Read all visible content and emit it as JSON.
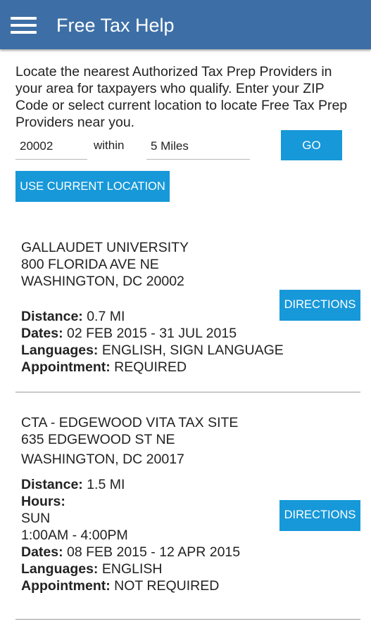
{
  "app": {
    "title": "Free Tax Help"
  },
  "intro": "Locate the nearest Authorized Tax Prep Providers in your area for taxpayers who qualify. Enter your ZIP Code or select current location to locate Free Tax Prep Providers near you.",
  "search": {
    "zip_value": "20002",
    "within_label": "within",
    "range_value": "5 Miles",
    "go_label": "GO",
    "use_location_label": "USE CURRENT LOCATION"
  },
  "labels": {
    "distance": "Distance:",
    "hours": "Hours:",
    "dates": "Dates:",
    "languages": "Languages:",
    "appointment": "Appointment:",
    "directions": "DIRECTIONS"
  },
  "results": [
    {
      "name": "GALLAUDET UNIVERSITY",
      "address1": "800 FLORIDA AVE NE",
      "address2": "WASHINGTON, DC 20002",
      "distance": "0.7 MI",
      "dates": "02 FEB 2015 - 31 JUL 2015",
      "languages": "ENGLISH, SIGN LANGUAGE",
      "appointment": "REQUIRED"
    },
    {
      "name": "CTA - EDGEWOOD VITA TAX SITE",
      "address1": "635 EDGEWOOD ST NE",
      "address2": "WASHINGTON, DC 20017",
      "distance": "1.5 MI",
      "hours_day": "SUN",
      "hours_time": "1:00AM - 4:00PM",
      "dates": "08 FEB 2015 - 12 APR 2015",
      "languages": "ENGLISH",
      "appointment": "NOT REQUIRED"
    }
  ]
}
